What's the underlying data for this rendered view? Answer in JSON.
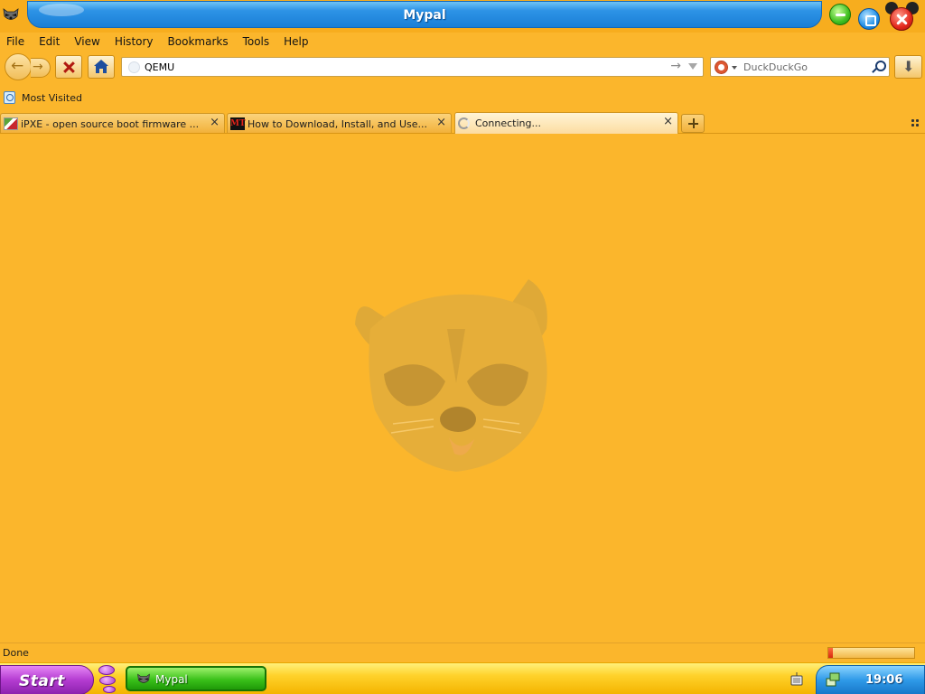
{
  "window": {
    "title": "Mypal"
  },
  "menu": [
    "File",
    "Edit",
    "View",
    "History",
    "Bookmarks",
    "Tools",
    "Help"
  ],
  "navbar": {
    "url": "QEMU",
    "search_placeholder": "DuckDuckGo"
  },
  "bookmarks": {
    "most_visited": "Most Visited"
  },
  "tabs": [
    {
      "label": "iPXE - open source boot firmware ...",
      "close": "×",
      "icon": "ipxe-favicon"
    },
    {
      "label": "How to Download, Install, and Use...",
      "close": "×",
      "icon": "mt-favicon",
      "icon_text": "MT"
    },
    {
      "label": "Connecting...",
      "close": "×",
      "icon": "loading-spinner-icon",
      "active": true
    }
  ],
  "status": {
    "text": "Done",
    "progress": 0.05
  },
  "taskbar": {
    "start_label": "Start",
    "task_label": "Mypal",
    "clock": "19:06"
  },
  "colors": {
    "background": "#fbb62c",
    "titlebar_blue": "#1a7fd6",
    "start_purple": "#b43cd1",
    "task_green": "#3ac11a"
  }
}
